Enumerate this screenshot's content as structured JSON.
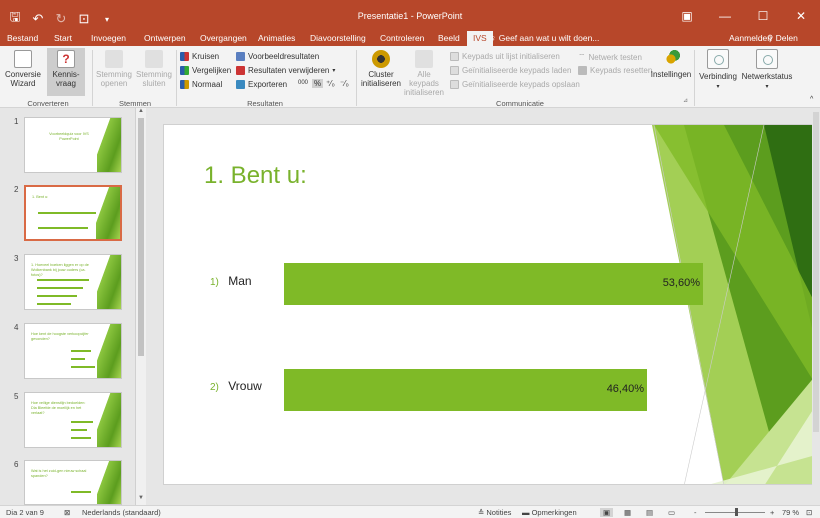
{
  "titlebar": {
    "title": "Presentatie1 - PowerPoint",
    "win_min": "—",
    "win_max": "☐",
    "win_close": "✕",
    "ribbon_display": "▣"
  },
  "tabs": [
    {
      "label": "Bestand"
    },
    {
      "label": "Start"
    },
    {
      "label": "Invoegen"
    },
    {
      "label": "Ontwerpen"
    },
    {
      "label": "Overgangen"
    },
    {
      "label": "Animaties"
    },
    {
      "label": "Diavoorstelling"
    },
    {
      "label": "Controleren"
    },
    {
      "label": "Beeld"
    },
    {
      "label": "IVS"
    }
  ],
  "tellme": "♀ Geef aan wat u wilt doen...",
  "aanmelden": "Aanmelden",
  "delen": "Delen",
  "ribbon": {
    "conversie": {
      "line1": "Conversie",
      "line2": "Wizard"
    },
    "kennis": {
      "line1": "Kennis-",
      "line2": "vraag"
    },
    "stemming_openen": {
      "line1": "Stemming",
      "line2": "openen"
    },
    "stemming_sluiten": {
      "line1": "Stemming",
      "line2": "sluiten"
    },
    "kruisen": "Kruisen",
    "vergelijken": "Vergelijken",
    "normaal": "Normaal",
    "voorbeeldresultaten": "Voorbeeldresultaten",
    "resultaten_verwijderen": "Resultaten verwijderen",
    "exporteren": "Exporteren",
    "format_000": "000",
    "format_pct": "%",
    "cluster": {
      "line1": "Cluster",
      "line2": "initialiseren"
    },
    "alle_keypads": {
      "line1": "Alle keypads",
      "line2": "initialiseren"
    },
    "keypads_uit_lijst": "Keypads uit lijst initialiseren",
    "geinit_laden": "Geïnitialiseerde keypads laden",
    "geinit_opslaan": "Geïnitialiseerde keypads opslaan",
    "netwerk_testen": "Netwerk testen",
    "keypads_resetten": "Keypads resetten",
    "instellingen": "Instellingen",
    "verbinding": "Verbinding",
    "netwerkstatus": "Netwerkstatus",
    "group_converteren": "Converteren",
    "group_stemmen": "Stemmen",
    "group_resultaten": "Resultaten",
    "group_communicatie": "Communicatie"
  },
  "thumbnails": [
    {
      "num": "1",
      "text": "Voorbeeldquiz voor IVS PowerPoint"
    },
    {
      "num": "2",
      "text": "1. Bent u:"
    },
    {
      "num": "3",
      "text": "1. Hoeveel boeken liggen er op de Wolkenbank bij jouw ouders (ca. fotos)?"
    },
    {
      "num": "4",
      "text": "Hoe kent de hoogste verkoopcijfer gevonden?"
    },
    {
      "num": "5",
      "text": "Hoe veilige dienstlijn bedoelden: Dla Bleefde de moeilijk en het verlaat?"
    },
    {
      "num": "6",
      "text": "Wat is het zuid-gen nieuw schaal spanden?"
    }
  ],
  "slide": {
    "title": "1.  Bent u:",
    "options": [
      {
        "num": "1)",
        "label": "Man",
        "value_text": "53,60%",
        "value": 53.6
      },
      {
        "num": "2)",
        "label": "Vrouw",
        "value_text": "46,40%",
        "value": 46.4
      }
    ]
  },
  "statusbar": {
    "slide_counter": "Dia 2 van 9",
    "language": "Nederlands (standaard)",
    "notities": "Notities",
    "opmerkingen": "Opmerkingen",
    "zoom_minus": "-",
    "zoom_plus": "+",
    "zoom": "79 %",
    "zoom_level": 0.79
  },
  "colors": {
    "accent": "#b7472a",
    "green": "#7fba27"
  }
}
